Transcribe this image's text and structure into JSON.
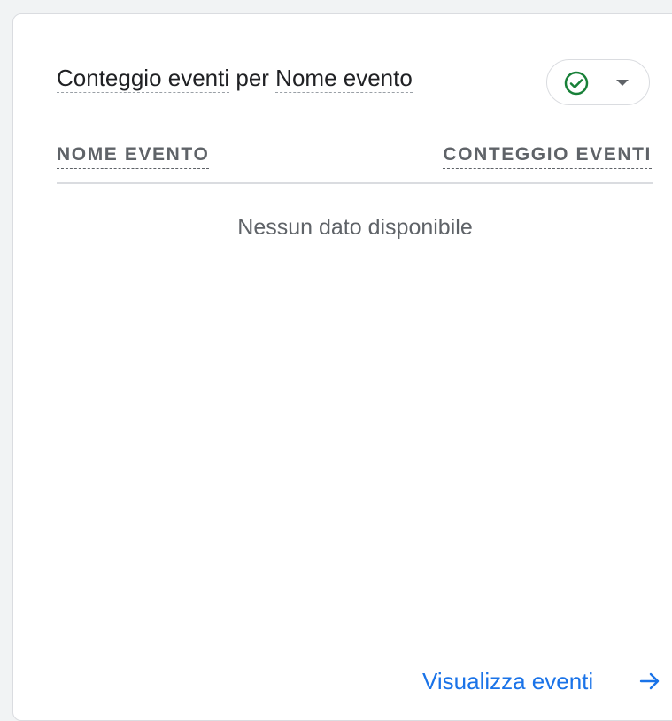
{
  "card": {
    "title": {
      "part1": "Conteggio eventi",
      "connector": " per ",
      "part2": "Nome evento"
    },
    "status_icon": "check-circle-icon",
    "dropdown_icon": "caret-down-icon",
    "table": {
      "columns": [
        "NOME EVENTO",
        "CONTEGGIO EVENTI"
      ],
      "empty_message": "Nessun dato disponibile"
    },
    "footer_link": {
      "label": "Visualizza eventi",
      "icon": "arrow-right-icon"
    }
  },
  "colors": {
    "accent": "#1a73e8",
    "success": "#188038",
    "text": "#202124",
    "muted": "#5f6368"
  }
}
